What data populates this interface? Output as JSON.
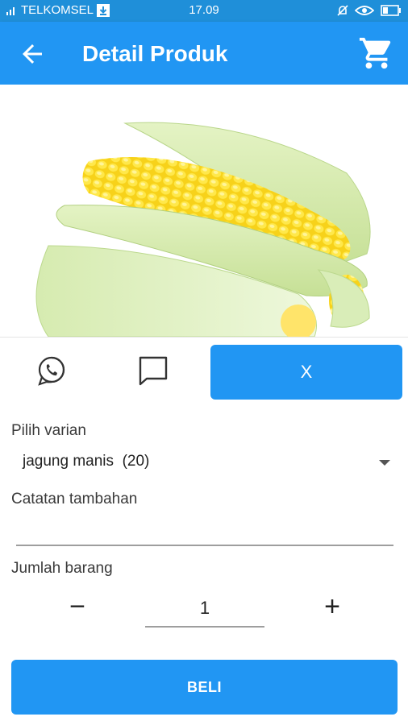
{
  "status_bar": {
    "carrier": "TELKOMSEL",
    "time": "17.09"
  },
  "app_bar": {
    "title": "Detail Produk",
    "back_icon": "arrow-left-icon",
    "cart_icon": "shopping-cart-icon"
  },
  "product": {
    "image_description_icon": "corn-image"
  },
  "actions": {
    "whatsapp_icon": "whatsapp-icon",
    "chat_icon": "chat-bubble-icon",
    "close_label": "X"
  },
  "form": {
    "variant_label": "Pilih varian",
    "variant_value": "jagung manis  (20)",
    "notes_label": "Catatan tambahan",
    "notes_value": "",
    "quantity_label": "Jumlah barang",
    "quantity_value": "1",
    "minus_symbol": "−",
    "plus_symbol": "+"
  },
  "buy_button": {
    "label": "BELI"
  },
  "colors": {
    "primary": "#2196f3",
    "status_bar": "#1f8fd9"
  }
}
